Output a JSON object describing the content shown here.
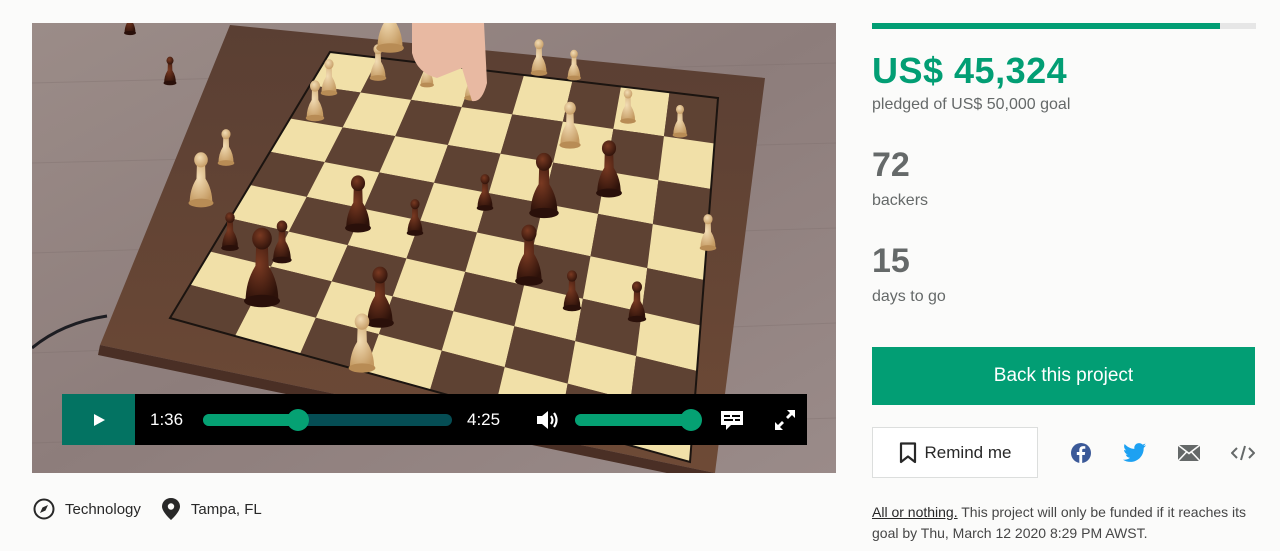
{
  "video": {
    "current_time": "1:36",
    "duration": "4:25",
    "seek_progress": 0.38,
    "volume_level": 0.98,
    "icons": {
      "play": "play-icon",
      "volume": "volume-icon",
      "captions": "captions-icon",
      "fullscreen": "fullscreen-icon"
    },
    "scene_description": "Wooden chessboard with chess pieces, a hand moving a white piece"
  },
  "project_meta": {
    "category": "Technology",
    "category_icon": "compass-icon",
    "location": "Tampa, FL",
    "location_icon": "map-pin-icon"
  },
  "funding": {
    "progress": 0.906,
    "pledged": "US$ 45,324",
    "pledged_sub": "pledged of US$ 50,000 goal",
    "backers_count": "72",
    "backers_label": "backers",
    "days_count": "15",
    "days_label": "days to go",
    "accent_color": "#029e74"
  },
  "actions": {
    "back_label": "Back this project",
    "remind_label": "Remind me",
    "share": [
      {
        "name": "facebook-icon",
        "color": "#3b5998"
      },
      {
        "name": "twitter-icon",
        "color": "#1da1f2"
      },
      {
        "name": "email-icon",
        "color": "#656969"
      },
      {
        "name": "embed-icon",
        "color": "#656969"
      }
    ]
  },
  "fineprint": {
    "link": "All or nothing.",
    "text": " This project will only be funded if it reaches its goal by Thu, March 12 2020 8:29 PM AWST."
  }
}
